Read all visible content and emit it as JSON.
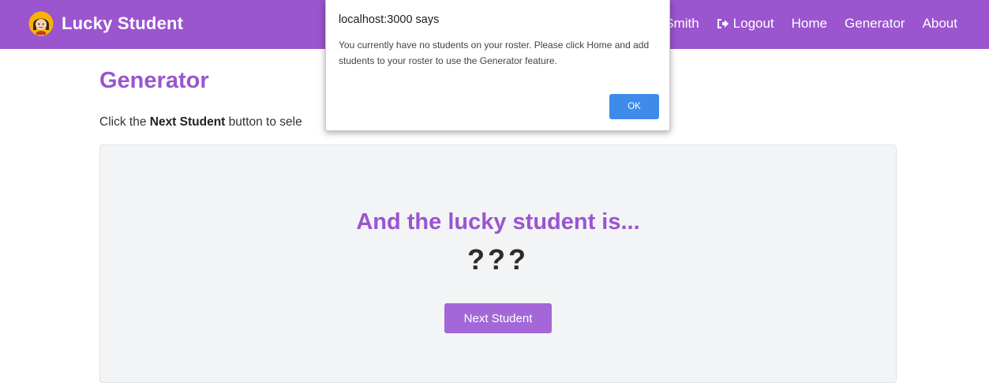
{
  "navbar": {
    "brand": "Lucky Student",
    "user_name": "Smith",
    "logout_label": "Logout",
    "links": [
      "Home",
      "Generator",
      "About"
    ]
  },
  "page": {
    "title": "Generator",
    "instructions_prefix": "Click the ",
    "instructions_bold": "Next Student",
    "instructions_suffix": " button to sele"
  },
  "panel": {
    "heading": "And the lucky student is...",
    "student": "???",
    "next_button": "Next Student"
  },
  "dialog": {
    "title": "localhost:3000 says",
    "message": "You currently have no students on your roster. Please click Home and add students to your roster to use the Generator feature.",
    "ok_label": "OK"
  },
  "colors": {
    "brand_purple": "#9a55cf",
    "button_purple": "#a367d8",
    "dialog_button_blue": "#3e8bea",
    "panel_background": "#f3f4f6"
  }
}
